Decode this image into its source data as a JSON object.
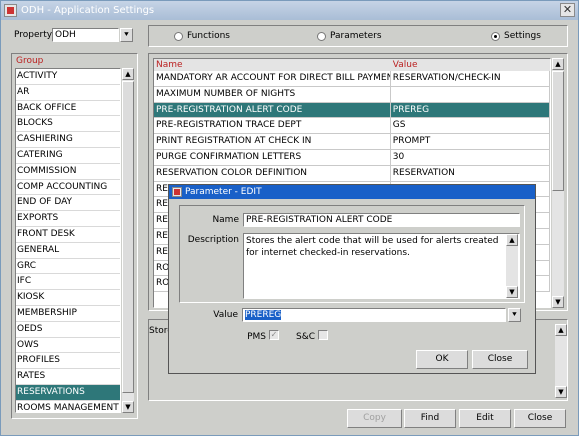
{
  "window": {
    "title": "ODH - Application Settings",
    "close_glyph": "✕"
  },
  "property": {
    "label": "Property",
    "value": "ODH"
  },
  "radios": [
    {
      "label": "Functions",
      "selected": false
    },
    {
      "label": "Parameters",
      "selected": false
    },
    {
      "label": "Settings",
      "selected": true
    }
  ],
  "group": {
    "header": "Group",
    "items": [
      "ACTIVITY",
      "AR",
      "BACK OFFICE",
      "BLOCKS",
      "CASHIERING",
      "CATERING",
      "COMMISSION",
      "COMP ACCOUNTING",
      "END OF DAY",
      "EXPORTS",
      "FRONT DESK",
      "GENERAL",
      "GRC",
      "IFC",
      "KIOSK",
      "MEMBERSHIP",
      "OEDS",
      "OWS",
      "PROFILES",
      "RATES",
      "RESERVATIONS",
      "ROOMS MANAGEMENT"
    ],
    "selected_index": 20
  },
  "grid": {
    "columns": [
      "Name",
      "Value"
    ],
    "rows": [
      [
        "MANDATORY AR ACCOUNT FOR DIRECT BILL PAYMENT",
        "RESERVATION/CHECK-IN"
      ],
      [
        "MAXIMUM NUMBER OF NIGHTS",
        ""
      ],
      [
        "PRE-REGISTRATION ALERT CODE",
        "PREREG"
      ],
      [
        "PRE-REGISTRATION TRACE DEPT",
        "GS"
      ],
      [
        "PRINT REGISTRATION AT CHECK IN",
        "PROMPT"
      ],
      [
        "PURGE CONFIRMATION LETTERS",
        "30"
      ],
      [
        "RESERVATION COLOR DEFINITION",
        "RESERVATION"
      ],
      [
        "RE",
        ""
      ],
      [
        "RE",
        ""
      ],
      [
        "RE",
        ""
      ],
      [
        "RE",
        ""
      ],
      [
        "RE",
        ""
      ],
      [
        "RO",
        ""
      ],
      [
        "RO",
        ""
      ]
    ],
    "selected_index": 2
  },
  "store_label": "Store",
  "buttons": {
    "copy": "Copy",
    "find": "Find",
    "edit": "Edit",
    "close": "Close"
  },
  "dialog": {
    "title": "Parameter - EDIT",
    "name_label": "Name",
    "name_value": "PRE-REGISTRATION ALERT CODE",
    "description_label": "Description",
    "description_value": "Stores the alert code that will be used for alerts created for internet checked-in reservations.",
    "value_label": "Value",
    "value_value": "PREREG",
    "pms_label": "PMS",
    "pms_checked": true,
    "sc_label": "S&C",
    "sc_checked": false,
    "ok_label": "OK",
    "close_label": "Close"
  }
}
